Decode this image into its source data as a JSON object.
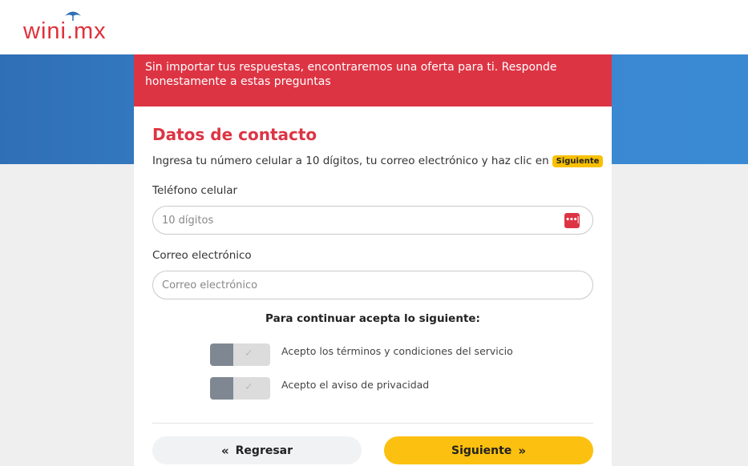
{
  "brand": {
    "logo_text": "wini.mx",
    "color": "#e0303a"
  },
  "notice": {
    "text": "Sin importar tus respuestas, encontraremos una oferta para ti. Responde honestamente a estas preguntas"
  },
  "form": {
    "title": "Datos de contacto",
    "instruction": "Ingresa tu número celular a 10 dígitos, tu correo electrónico y haz clic en",
    "instruction_badge": "Siguiente",
    "phone": {
      "label": "Teléfono celular",
      "placeholder": "10 dígitos",
      "value": "",
      "icon": "password-manager-icon"
    },
    "email": {
      "label": "Correo electrónico",
      "placeholder": "Correo electrónico",
      "value": ""
    },
    "accept_heading": "Para continuar acepta lo siguiente:",
    "terms": {
      "label": "Acepto los términos y condiciones del servicio",
      "checked": false
    },
    "privacy": {
      "label": "Acepto el aviso de privacidad",
      "checked": false
    }
  },
  "buttons": {
    "back_label": "Regresar",
    "back_icon": "«",
    "next_label": "Siguiente",
    "next_icon": "»"
  },
  "colors": {
    "accent_red": "#dd3444",
    "accent_yellow": "#fcc010",
    "band_blue": "#3b86cf"
  }
}
